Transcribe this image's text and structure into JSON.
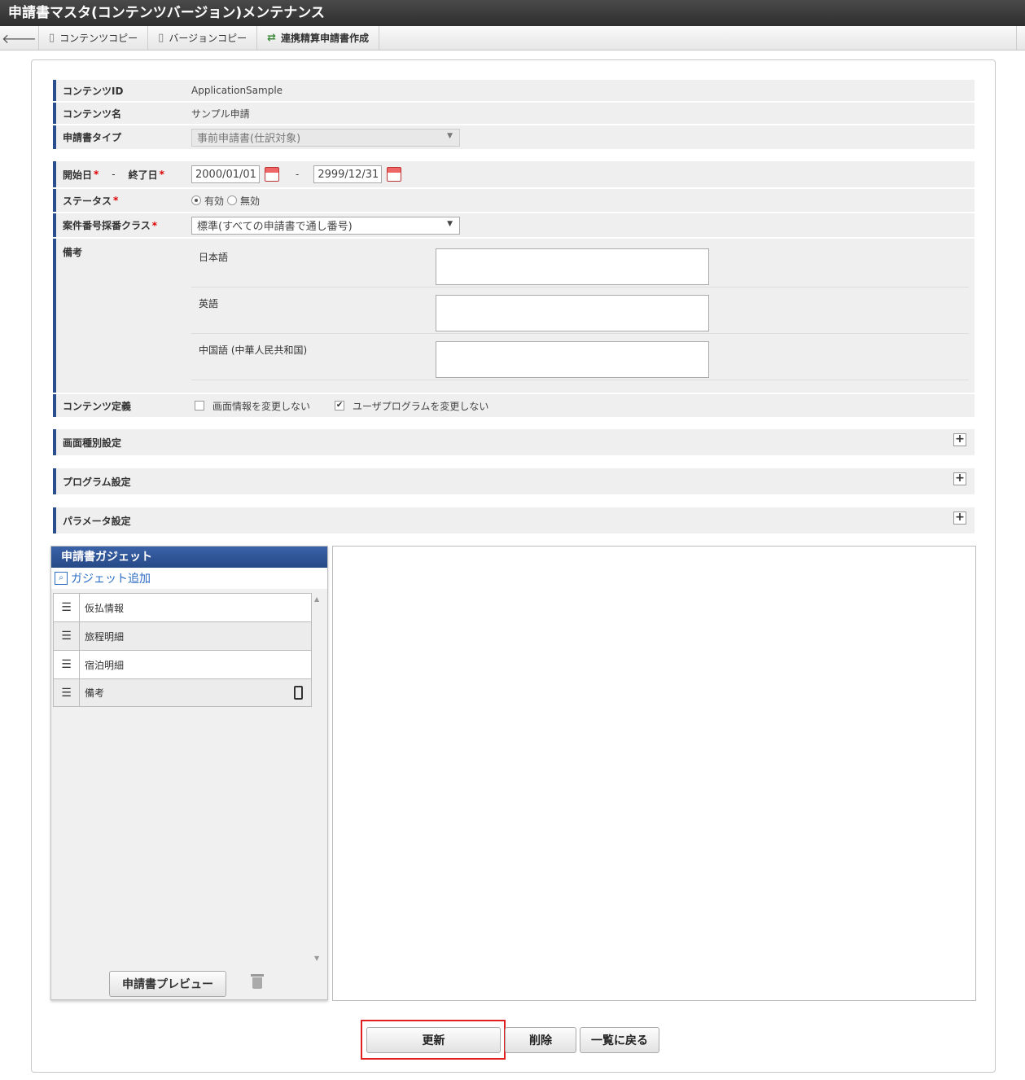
{
  "window": {
    "title": "申請書マスタ(コンテンツバージョン)メンテナンス"
  },
  "toolbar": {
    "back_icon": "arrow-left-icon",
    "content_copy": "コンテンツコピー",
    "version_copy": "バージョンコピー",
    "linked_settlement": "連携精算申請書作成"
  },
  "form": {
    "content_id": {
      "label": "コンテンツID",
      "value": "ApplicationSample"
    },
    "content_name": {
      "label": "コンテンツ名",
      "value": "サンプル申請"
    },
    "app_type": {
      "label": "申請書タイプ",
      "value": "事前申請書(仕訳対象)"
    },
    "period": {
      "start_label": "開始日",
      "end_label": "終了日",
      "required_mark": "*",
      "dash": "-",
      "start": "2000/01/01",
      "end": "2999/12/31"
    },
    "status": {
      "label": "ステータス",
      "options": [
        "有効",
        "無効"
      ],
      "selected": "有効"
    },
    "numbering": {
      "label": "案件番号採番クラス",
      "value": "標準(すべての申請書で通し番号)"
    },
    "note": {
      "label": "備考",
      "languages": [
        "日本語",
        "英語",
        "中国語 (中華人民共和国)"
      ]
    },
    "content_def": {
      "label": "コンテンツ定義",
      "screen_info": {
        "label": "画面情報を変更しない",
        "checked": false
      },
      "user_program": {
        "label": "ユーザプログラムを変更しない",
        "checked": true
      }
    }
  },
  "sections": [
    "画面種別設定",
    "プログラム設定",
    "パラメータ設定"
  ],
  "gadget": {
    "title": "申請書ガジェット",
    "add_label": "ガジェット追加",
    "items": [
      "仮払情報",
      "旅程明細",
      "宿泊明細",
      "備考"
    ],
    "preview_label": "申請書プレビュー"
  },
  "actions": {
    "update": "更新",
    "delete": "削除",
    "back_to_list": "一覧に戻る"
  }
}
